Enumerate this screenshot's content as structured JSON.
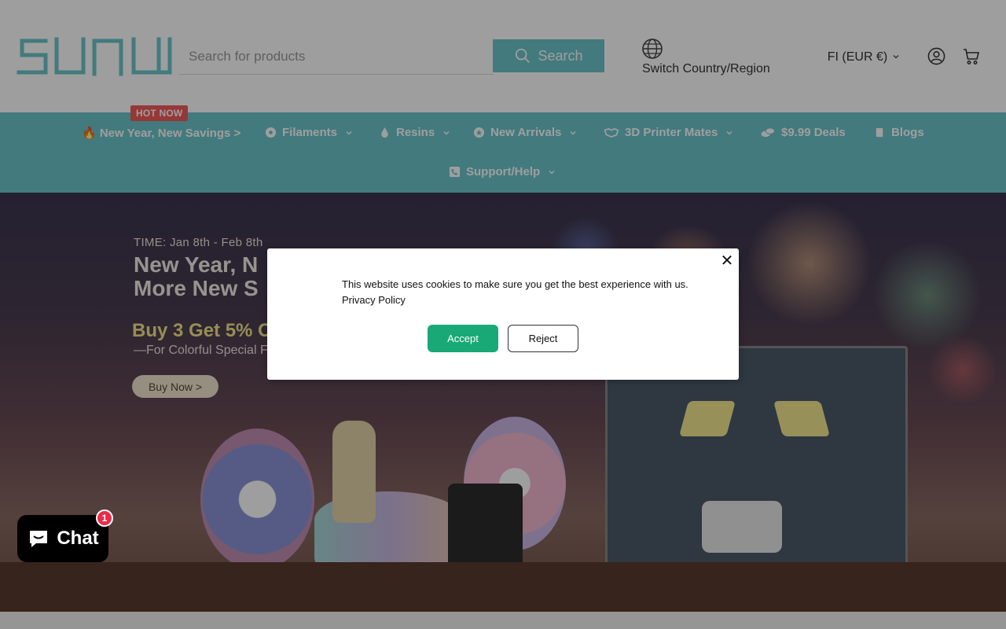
{
  "header": {
    "logo_text": "SUNLU",
    "search": {
      "placeholder": "Search for products",
      "button_label": "Search"
    },
    "region": {
      "label": "Switch Country/Region",
      "icon": "globe-icon"
    },
    "currency": {
      "label": "FI (EUR €)"
    },
    "account_icon": "account-icon",
    "cart_icon": "cart-icon"
  },
  "nav": {
    "hot_badge": "HOT NOW",
    "items": [
      {
        "label": "🔥 New Year, New Savings >",
        "icon": ""
      },
      {
        "label": "Filaments",
        "icon": "filament-icon",
        "has_dropdown": true
      },
      {
        "label": "Resins",
        "icon": "droplet-icon",
        "has_dropdown": true
      },
      {
        "label": "New Arrivals",
        "icon": "star-badge-icon",
        "has_dropdown": true
      },
      {
        "label": "3D Printer Mates",
        "icon": "handshake-icon",
        "has_dropdown": true
      },
      {
        "label": "$9.99 Deals",
        "icon": "coins-icon",
        "has_dropdown": false
      },
      {
        "label": "Blogs",
        "icon": "book-icon",
        "has_dropdown": false
      },
      {
        "label": "Support/Help",
        "icon": "phone-icon",
        "has_dropdown": true
      }
    ]
  },
  "hero": {
    "time": "TIME:  Jan 8th - Feb 8th",
    "headline_line1": "New Year, N",
    "headline_line2": "More New S",
    "promo": "Buy 3 Get 5% O",
    "subline": "—For Colorful Special Fi",
    "cta": "Buy Now >"
  },
  "cookie_modal": {
    "message": "This website uses cookies to make sure you get the best experience with us.",
    "policy_link": "Privacy Policy",
    "accept_label": "Accept",
    "reject_label": "Reject",
    "close_symbol": "✕"
  },
  "chat": {
    "label": "Chat",
    "badge_count": "1"
  },
  "colors": {
    "brand_teal": "#6cc5cc",
    "accept_green": "#18a977",
    "hot_red": "#f25b5b"
  }
}
